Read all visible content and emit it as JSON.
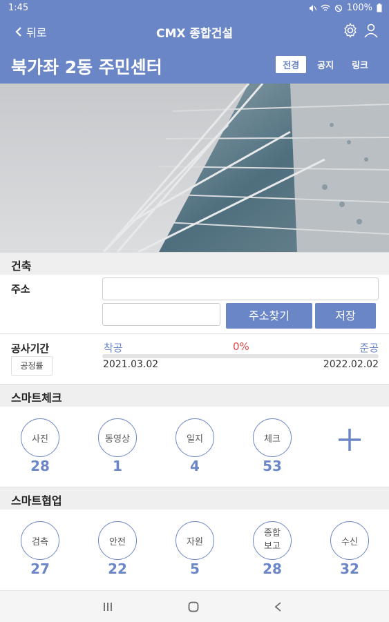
{
  "status": {
    "time": "1:45",
    "battery": "100%"
  },
  "appbar": {
    "back_label": "뒤로",
    "title": "CMX 종합건설"
  },
  "page": {
    "title": "북가좌 2동 주민센터",
    "tabs": [
      {
        "label": "전경",
        "active": true
      },
      {
        "label": "공지"
      },
      {
        "label": "링크"
      }
    ]
  },
  "sections": {
    "architecture": "건축",
    "smart_check": "스마트체크",
    "smart_collab": "스마트협업"
  },
  "address": {
    "label": "주소",
    "line1": "",
    "line2": "",
    "find_button": "주소찾기",
    "save_button": "저장"
  },
  "period": {
    "label": "공사기간",
    "progress_button": "공정률",
    "start_label": "착공",
    "end_label": "준공",
    "progress_text": "0%",
    "progress_value": 0,
    "start_date": "2021.03.02",
    "end_date": "2022.02.02"
  },
  "smart_check": [
    {
      "label": "사진",
      "count": "28"
    },
    {
      "label": "동영상",
      "count": "1"
    },
    {
      "label": "일지",
      "count": "4"
    },
    {
      "label": "체크",
      "count": "53"
    }
  ],
  "smart_collab": [
    {
      "label": "검측",
      "count": "27"
    },
    {
      "label": "안전",
      "count": "22"
    },
    {
      "label": "자원",
      "count": "5"
    },
    {
      "label": "종합\n보고",
      "count": "28"
    },
    {
      "label": "수신",
      "count": "32"
    }
  ],
  "colors": {
    "primary": "#6b86c6",
    "danger": "#e04848",
    "background": "#f2f2f2"
  },
  "icons": {
    "status": [
      "mute-icon",
      "wifi-icon",
      "no-data-icon",
      "battery-icon"
    ],
    "appbar": [
      "settings-icon",
      "user-icon"
    ],
    "nav": [
      "recents-icon",
      "home-icon",
      "back-nav-icon"
    ]
  }
}
